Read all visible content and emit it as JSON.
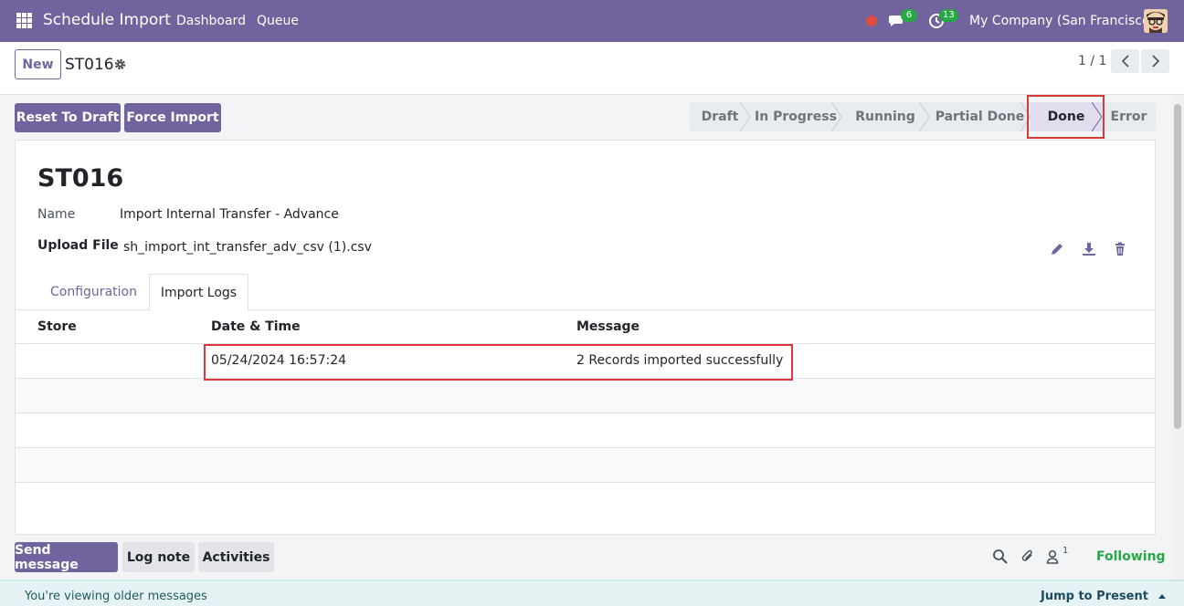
{
  "navbar": {
    "app_title": "Schedule Import",
    "menu": [
      "Dashboard",
      "Queue"
    ],
    "messages_badge": "6",
    "activities_badge": "13",
    "company": "My Company (San Francisco)"
  },
  "control": {
    "new_label": "New",
    "record_name": "ST016",
    "pager": "1 / 1"
  },
  "actions": {
    "reset_label": "Reset To Draft",
    "force_label": "Force Import"
  },
  "statusbar": {
    "stages": [
      "Draft",
      "In Progress",
      "Running",
      "Partial Done",
      "Done",
      "Error"
    ],
    "current": "Done"
  },
  "form": {
    "title": "ST016",
    "name_label": "Name",
    "name_value": "Import Internal Transfer - Advance",
    "upload_label": "Upload File",
    "upload_value": "sh_import_int_transfer_adv_csv (1).csv"
  },
  "tabs": {
    "items": [
      "Configuration",
      "Import Logs"
    ],
    "active": "Import Logs"
  },
  "logs_table": {
    "headers": [
      "Store",
      "Date & Time",
      "Message"
    ],
    "rows": [
      {
        "store": "",
        "datetime": "05/24/2024 16:57:24",
        "message": "2 Records imported successfully"
      }
    ]
  },
  "chatter": {
    "send_message": "Send message",
    "log_note": "Log note",
    "activities": "Activities",
    "followers_count": "1",
    "following": "Following",
    "older_messages": "You're viewing older messages",
    "jump_to_present": "Jump to Present"
  },
  "colors": {
    "brand": "#71639e",
    "success": "#28a745",
    "highlight": "#d9373a"
  }
}
